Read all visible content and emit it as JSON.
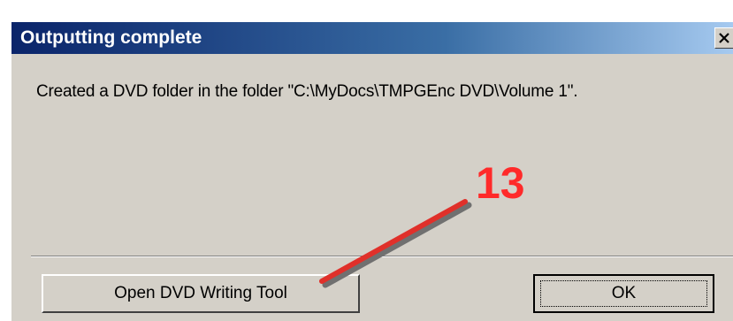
{
  "dialog": {
    "title": "Outputting complete",
    "message": "Created a DVD folder in the folder \"C:\\MyDocs\\TMPGEnc DVD\\Volume 1\".",
    "buttons": {
      "open_label": "Open DVD Writing Tool",
      "ok_label": "OK"
    }
  },
  "annotation": {
    "number": "13",
    "color": "#ff2a2a"
  },
  "colors": {
    "titlebar_start": "#0a246a",
    "titlebar_end": "#a6caf0",
    "dialog_bg": "#d4d0c8"
  },
  "icons": {
    "close": "close-icon"
  }
}
